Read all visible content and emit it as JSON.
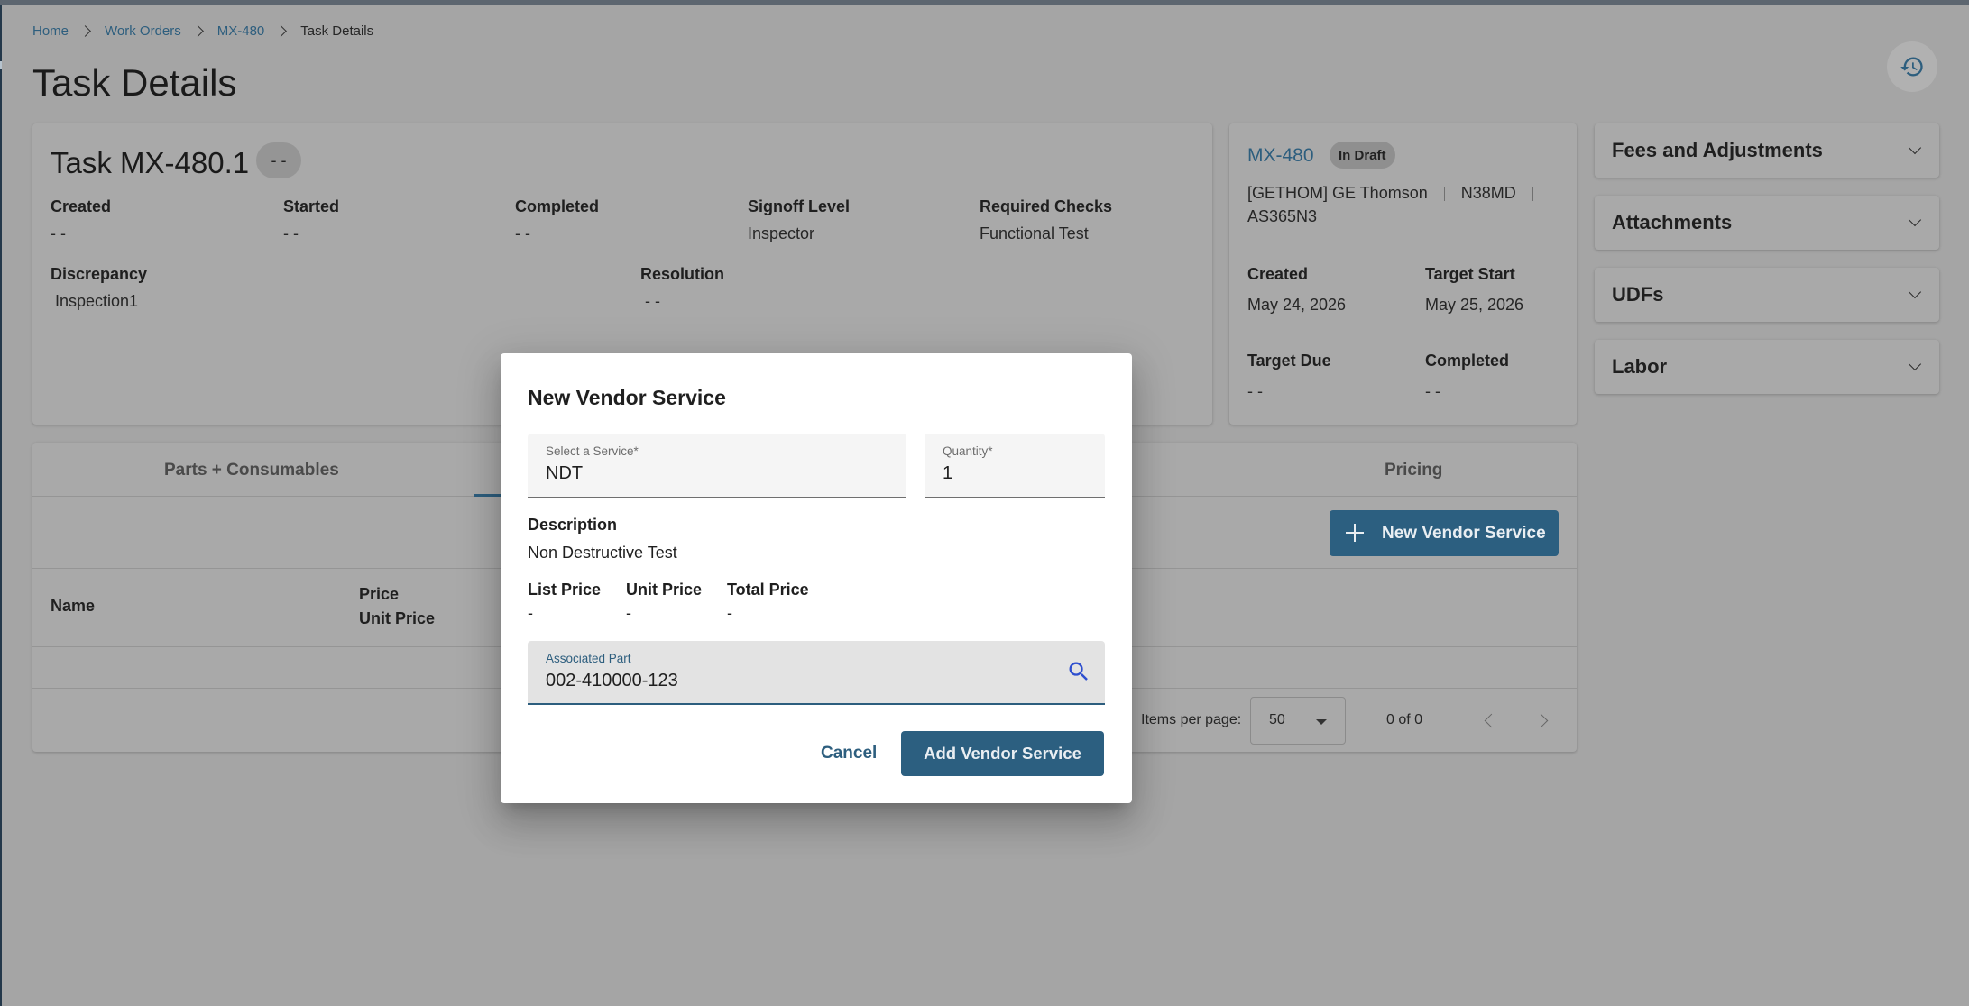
{
  "breadcrumb": {
    "items": [
      {
        "label": "Home"
      },
      {
        "label": "Work Orders"
      },
      {
        "label": "MX-480"
      },
      {
        "label": "Task Details"
      }
    ]
  },
  "page": {
    "title": "Task Details",
    "history_icon": "history-icon"
  },
  "task": {
    "title": "Task MX-480.1",
    "status_chip": "- -",
    "fields": {
      "created": {
        "label": "Created",
        "value": "- -"
      },
      "started": {
        "label": "Started",
        "value": "- -"
      },
      "completed": {
        "label": "Completed",
        "value": "- -"
      },
      "signoff": {
        "label": "Signoff Level",
        "value": "Inspector"
      },
      "checks": {
        "label": "Required Checks",
        "value": "Functional Test"
      },
      "discrepancy": {
        "label": "Discrepancy",
        "value": "Inspection1"
      },
      "resolution": {
        "label": "Resolution",
        "value": "- -"
      }
    }
  },
  "work_order": {
    "id": "MX-480",
    "status": "In Draft",
    "customer": "[GETHOM] GE Thomson",
    "tail": "N38MD",
    "model": "AS365N3",
    "fields": {
      "created": {
        "label": "Created",
        "value": "May 24, 2026"
      },
      "target_start": {
        "label": "Target Start",
        "value": "May 25, 2026"
      },
      "target_due": {
        "label": "Target Due",
        "value": "- -"
      },
      "completed": {
        "label": "Completed",
        "value": "- -"
      }
    }
  },
  "panels": [
    {
      "title": "Fees and Adjustments"
    },
    {
      "title": "Attachments"
    },
    {
      "title": "UDFs"
    },
    {
      "title": "Labor"
    }
  ],
  "tabs": {
    "parts": "Parts + Consumables",
    "pricing": "Pricing"
  },
  "toolbar": {
    "new_vendor_service": "New Vendor Service"
  },
  "table": {
    "columns": {
      "name": "Name",
      "price": "Price",
      "unit_price": "Unit Price"
    }
  },
  "paginator": {
    "items_per_page_label": "Items per page:",
    "page_size": "50",
    "range": "0 of 0"
  },
  "dialog": {
    "title": "New Vendor Service",
    "service": {
      "label": "Select a Service",
      "required": "*",
      "value": "NDT"
    },
    "quantity": {
      "label": "Quantity",
      "required": "*",
      "value": "1"
    },
    "description_label": "Description",
    "description_value": "Non Destructive Test",
    "list_price": {
      "label": "List Price",
      "value": "-"
    },
    "unit_price": {
      "label": "Unit Price",
      "value": "-"
    },
    "total_price": {
      "label": "Total Price",
      "value": "-"
    },
    "associated_part": {
      "label": "Associated Part",
      "value": "002-410000-123"
    },
    "cancel": "Cancel",
    "submit": "Add Vendor Service"
  },
  "colors": {
    "accent": "#2c5f80",
    "overlay_background": "#a5a5a5",
    "dialog_background": "#ffffff"
  }
}
